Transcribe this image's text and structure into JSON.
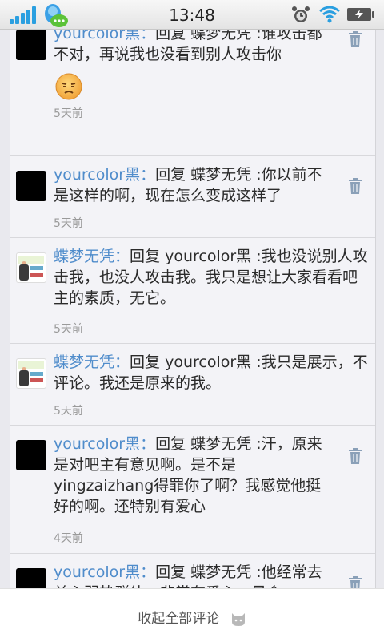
{
  "status_bar": {
    "time": "13:48"
  },
  "comments": [
    {
      "author": "yourcolor黑",
      "sep": "：",
      "reply_prefix": "回复",
      "reply_to": "蝶梦无凭",
      "text": "谁攻击都不对，再说我也没看到别人攻击你",
      "time": "5天前",
      "avatar": "black",
      "emoji": "frown-emoji"
    },
    {
      "author": "yourcolor黑",
      "sep": "：",
      "reply_prefix": "回复",
      "reply_to": "蝶梦无凭",
      "text": "你以前不是这样的啊，现在怎么变成这样了",
      "time": "5天前",
      "avatar": "black"
    },
    {
      "author": "蝶梦无凭",
      "sep": "：",
      "reply_prefix": "回复",
      "reply_to": "yourcolor黑",
      "text": "我也没说别人攻击我，也没人攻击我。我只是想让大家看看吧主的素质，无它。",
      "time": "5天前",
      "avatar": "image"
    },
    {
      "author": "蝶梦无凭",
      "sep": "：",
      "reply_prefix": "回复",
      "reply_to": "yourcolor黑",
      "text": "我只是展示，不评论。我还是原来的我。",
      "time": "5天前",
      "avatar": "image"
    },
    {
      "author": "yourcolor黑",
      "sep": "：",
      "reply_prefix": "回复",
      "reply_to": "蝶梦无凭",
      "text": "汗，原来是对吧主有意见啊。是不是yingzaizhang得罪你了啊？我感觉他挺好的啊。还特别有爱心",
      "time": "4天前",
      "avatar": "black"
    },
    {
      "author": "yourcolor黑",
      "sep": "：",
      "reply_prefix": "回复",
      "reply_to": "蝶梦无凭",
      "text": "他经常去关心弱势群体，非常有爱心。是个",
      "avatar": "black"
    }
  ],
  "footer": {
    "collapse_label": "收起全部评论",
    "icon": "cat-icon"
  },
  "colors": {
    "author": "#4f8ccb",
    "accent": "#2a9fe0"
  }
}
